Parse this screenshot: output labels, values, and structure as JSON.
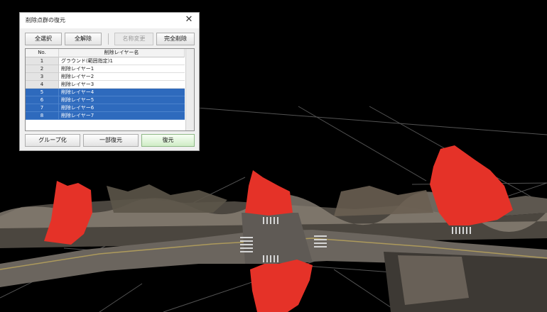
{
  "dialog": {
    "title": "削除点群の復元",
    "close_glyph": "✕",
    "toolbar": {
      "select_all": "全選択",
      "deselect_all": "全解除",
      "rename": "名称変更",
      "delete_all": "完全削除"
    },
    "table": {
      "columns": [
        "No.",
        "削除レイヤー名"
      ],
      "rows": [
        {
          "no": "1",
          "name": "グラウンド(範囲指定)1",
          "selected": false
        },
        {
          "no": "2",
          "name": "削除レイヤー1",
          "selected": false
        },
        {
          "no": "3",
          "name": "削除レイヤー2",
          "selected": false
        },
        {
          "no": "4",
          "name": "削除レイヤー3",
          "selected": false
        },
        {
          "no": "5",
          "name": "削除レイヤー4",
          "selected": true
        },
        {
          "no": "6",
          "name": "削除レイヤー5",
          "selected": true
        },
        {
          "no": "7",
          "name": "削除レイヤー6",
          "selected": true
        },
        {
          "no": "8",
          "name": "削除レイヤー7",
          "selected": true
        }
      ]
    },
    "footer": {
      "group": "グループ化",
      "partial_restore": "一部復元",
      "restore": "復元"
    }
  },
  "colors": {
    "selection": "#2e6abd",
    "deleted_points": "#e53228",
    "road": "#6d6760",
    "grid_lines": "#7a7a7a"
  }
}
